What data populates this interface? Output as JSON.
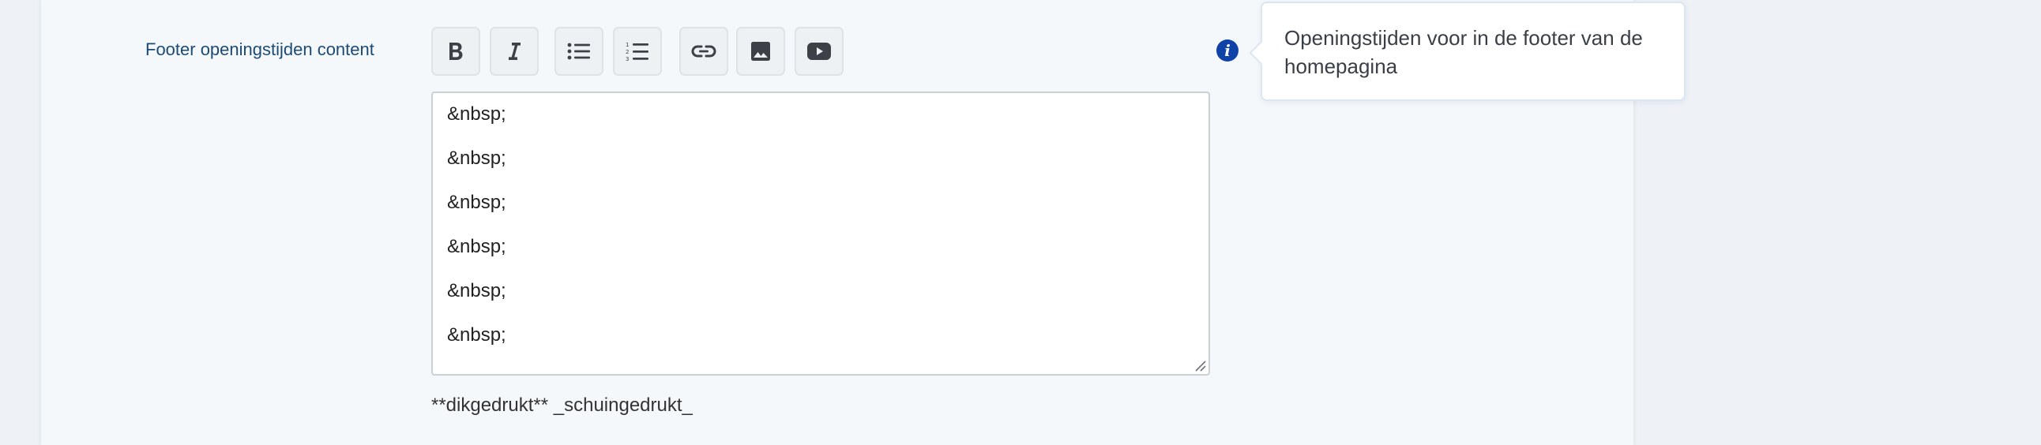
{
  "field": {
    "label": "Footer openingstijden content"
  },
  "toolbar": {
    "buttons": [
      {
        "name": "bold",
        "icon": "bold-icon"
      },
      {
        "name": "italic",
        "icon": "italic-icon"
      },
      {
        "name": "bulleted-list",
        "icon": "bulleted-list-icon"
      },
      {
        "name": "numbered-list",
        "icon": "numbered-list-icon"
      },
      {
        "name": "link",
        "icon": "link-icon"
      },
      {
        "name": "image",
        "icon": "image-icon"
      },
      {
        "name": "video",
        "icon": "video-icon"
      }
    ]
  },
  "editor": {
    "lines": [
      "&nbsp;",
      "&nbsp;",
      "&nbsp;",
      "&nbsp;",
      "&nbsp;",
      "&nbsp;"
    ]
  },
  "hint": {
    "text": "**dikgedrukt** _schuingedrukt_"
  },
  "info": {
    "icon": "info-icon",
    "icon_glyph": "i",
    "tooltip": "Openingstijden voor in de footer van de homepagina"
  },
  "colors": {
    "label": "#1c4a74",
    "info_icon": "#1142a8",
    "icon_dark": "#3d4147"
  }
}
